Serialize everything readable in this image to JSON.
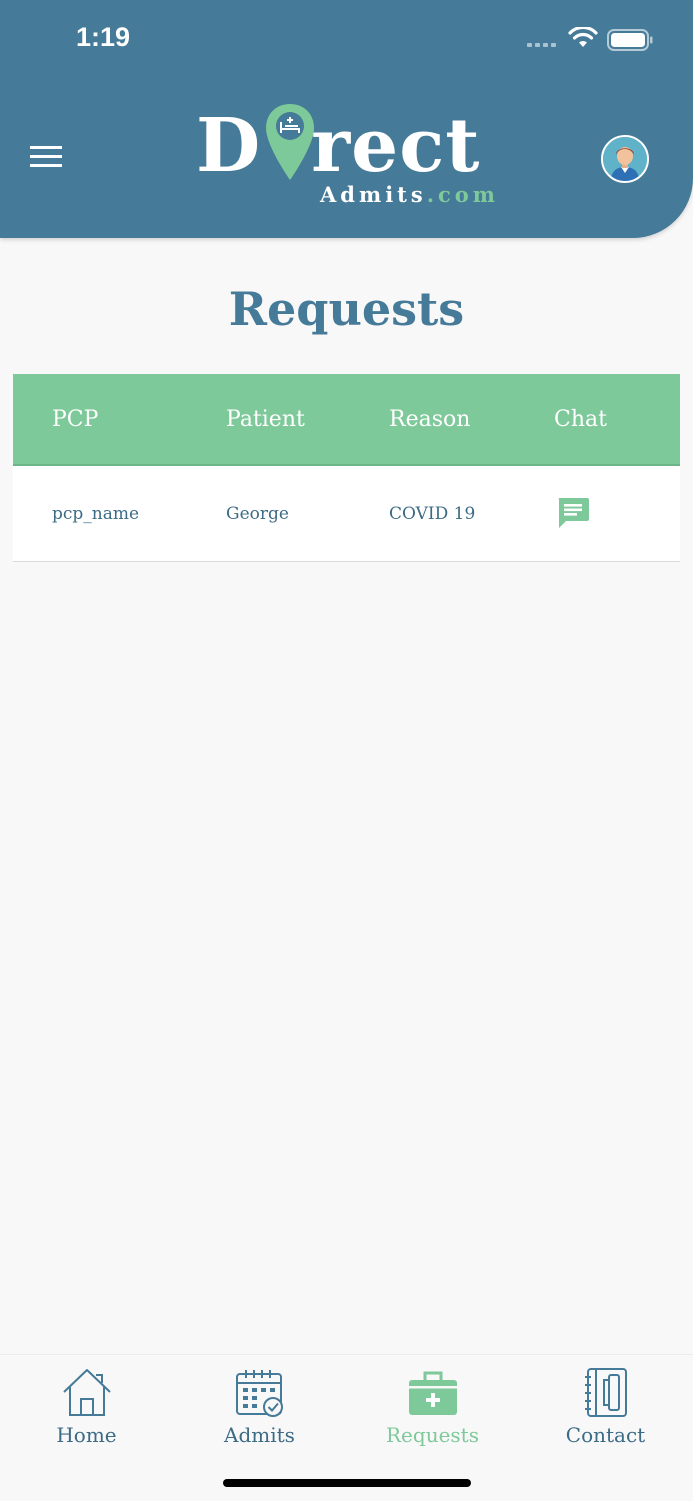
{
  "status_bar": {
    "time": "1:19"
  },
  "header": {
    "logo_main_before": "D",
    "logo_main_after": "rect",
    "logo_sub": "Admits",
    "logo_sub_suffix": ".com"
  },
  "page": {
    "title": "Requests"
  },
  "table": {
    "columns": [
      "PCP",
      "Patient",
      "Reason",
      "Chat"
    ],
    "rows": [
      {
        "pcp": "pcp_name",
        "patient": "George",
        "reason": "COVID 19",
        "chat_icon": "chat-icon"
      }
    ]
  },
  "tabs": [
    {
      "label": "Home",
      "icon": "house-icon",
      "active": false
    },
    {
      "label": "Admits",
      "icon": "calendar-check-icon",
      "active": false
    },
    {
      "label": "Requests",
      "icon": "medical-kit-icon",
      "active": true
    },
    {
      "label": "Contact",
      "icon": "phone-book-icon",
      "active": false
    }
  ],
  "colors": {
    "header_bg": "#457a98",
    "accent_green": "#7ec99a",
    "text_blue": "#3c6b86",
    "background": "#f8f8f8"
  }
}
